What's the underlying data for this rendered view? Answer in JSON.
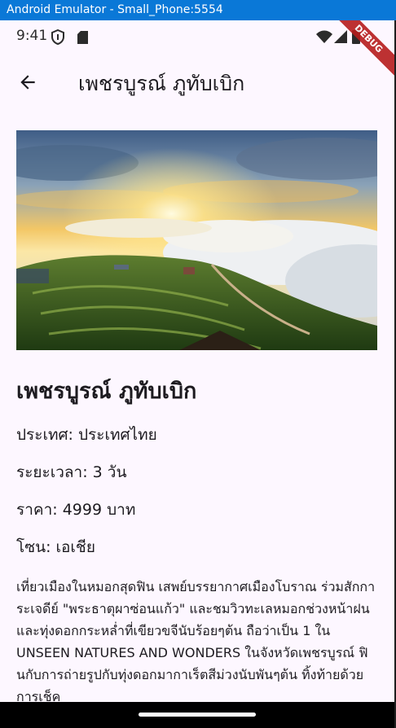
{
  "window": {
    "title": "Android Emulator - Small_Phone:5554"
  },
  "status_bar": {
    "time": "9:41",
    "icons": [
      "shield-icon",
      "sim-card-icon",
      "wifi-icon",
      "signal-icon",
      "battery-icon"
    ],
    "debug_banner": "DEBUG"
  },
  "app_bar": {
    "back_icon": "arrow-back-icon",
    "title": "เพชรบูรณ์ ภูทับเบิก"
  },
  "detail": {
    "image_alt": "sunset over sea of clouds and hillside farms",
    "title": "เพชรบูรณ์ ภูทับเบิก",
    "country": "ประเทศ: ประเทศไทย",
    "duration": "ระยะเวลา: 3 วัน",
    "price": "ราคา: 4999 บาท",
    "zone": "โซน: เอเชีย",
    "description": "เที่ยวเมืองในหมอกสุดฟิน เสพย์บรรยากาศเมืองโบราณ ร่วมสักการะเจดีย์ \"พระธาตุผาซ่อนแก้ว\" และชมวิวทะเลหมอกช่วงหน้าฝน และทุ่งดอกกระหล่ำที่เขียวขจีนับร้อยๆต้น ถือว่าเป็น 1 ใน UNSEEN NATURES AND WONDERS ในจังหวัดเพชรบูรณ์ ฟินกับการถ่ายรูปกับทุ่งดอกมากาเร็ตสีม่วงนับพันๆต้น ทิ้งท้ายด้วยการเช็ค"
  },
  "colors": {
    "titlebar": "#0a78d7",
    "background": "#fdf7ff",
    "text": "#1d1b20",
    "debug": "#b71c1c"
  }
}
